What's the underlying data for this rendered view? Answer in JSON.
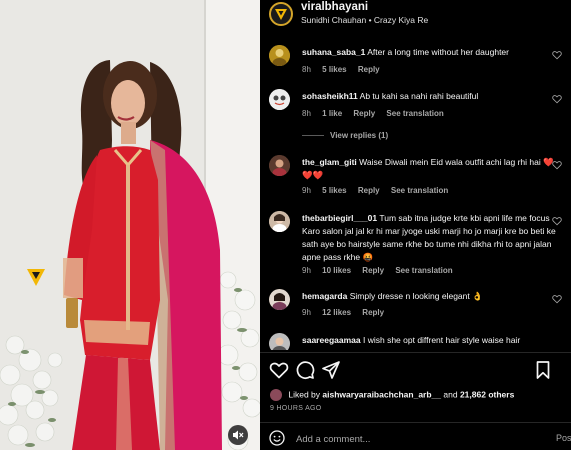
{
  "post": {
    "username": "viralbhayani",
    "audio": "Sunidhi Chauhan • Crazy Kiya Re"
  },
  "comments": [
    {
      "user": "suhana_saba_1",
      "text": "After a long time without her daughter",
      "time": "8h",
      "likes": "5 likes",
      "reply": "Reply",
      "see_translation": ""
    },
    {
      "user": "sohasheikh11",
      "text": "Ab tu kahi sa nahi rahi beautiful",
      "time": "8h",
      "likes": "1 like",
      "reply": "Reply",
      "see_translation": "See translation"
    },
    {
      "user": "the_glam_giti",
      "text": "Waise Diwali mein Eid wala outfit achi lag rhi hai ❤️❤️❤️",
      "time": "9h",
      "likes": "5 likes",
      "reply": "Reply",
      "see_translation": "See translation"
    },
    {
      "user": "thebarbiegirl___01",
      "text": "Tum sab itna judge krte kbi apni life me focus Karo salon jal jal kr hi mar jyoge uski marji ho jo marji kre bo beti ke sath aye bo hairstyle same rkhe bo tume nhi dikha rhi to apni jalan apne pass rkhe 🤬",
      "time": "9h",
      "likes": "10 likes",
      "reply": "Reply",
      "see_translation": "See translation"
    },
    {
      "user": "hemagarda",
      "text": "Simply dresse n looking elegant 👌",
      "time": "9h",
      "likes": "12 likes",
      "reply": "Reply",
      "see_translation": ""
    },
    {
      "user": "saareegaamaa",
      "text": "I wish she opt diffrent hair style waise hair",
      "time": "",
      "likes": "",
      "reply": "",
      "see_translation": ""
    }
  ],
  "view_replies": "View replies (1)",
  "likes": {
    "prefix": "Liked by",
    "user": "aishwaryaraibachchan_arb__",
    "and": "and",
    "others": "21,862 others"
  },
  "time_ago": "9 HOURS AGO",
  "add_comment": {
    "placeholder": "Add a comment...",
    "post_label": "Pos"
  },
  "icons": {
    "like": "heart-icon",
    "comment": "comment-icon",
    "share": "share-icon",
    "save": "bookmark-icon",
    "emoji": "emoji-icon",
    "mute": "speaker-muted-icon"
  },
  "colors": {
    "background": "#000000",
    "text": "#f5f5f5",
    "secondary": "#a8a8a8",
    "accent": "#d4a52a",
    "heart": "#ed4956"
  }
}
